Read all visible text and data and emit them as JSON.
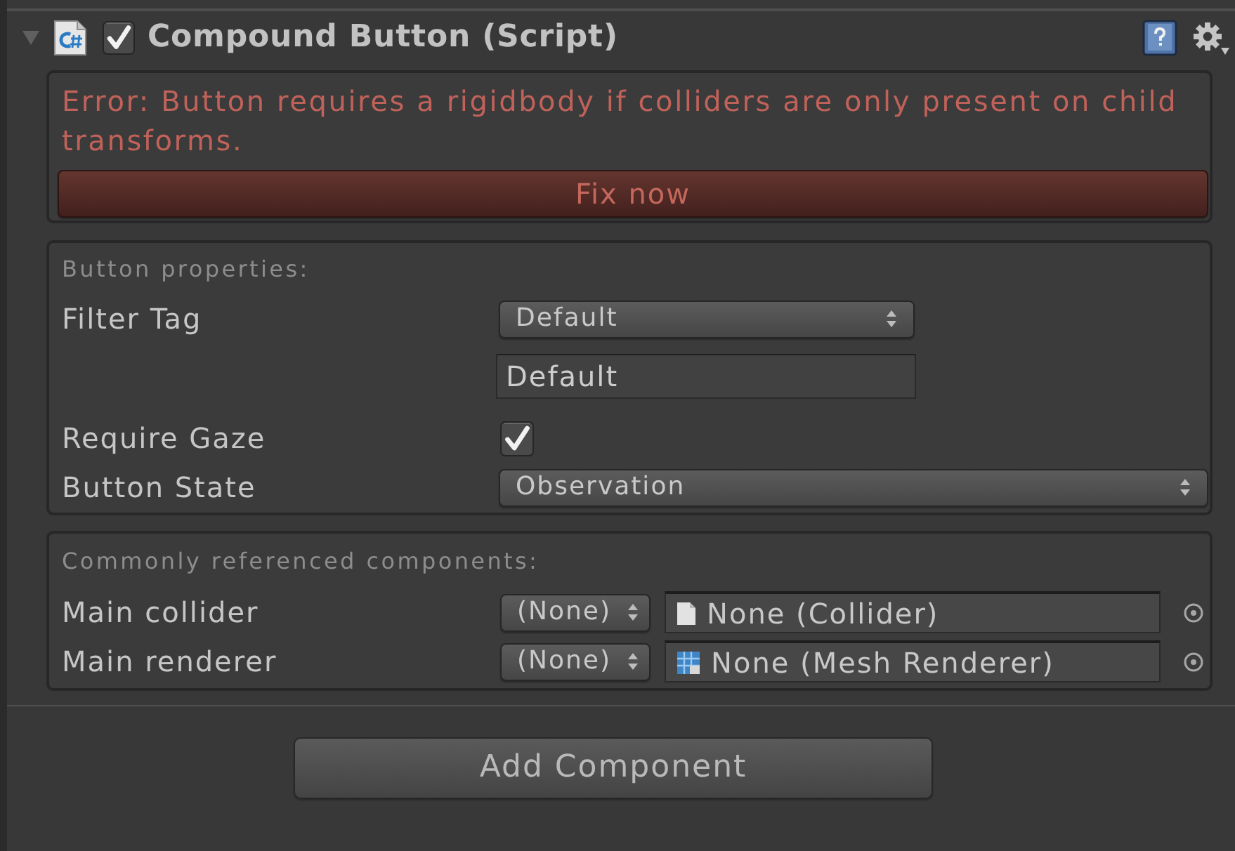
{
  "component": {
    "title": "Compound Button (Script)",
    "expanded": true,
    "enabled": true
  },
  "error": {
    "message": "Error: Button requires a rigidbody if colliders are only present on child transforms.",
    "fix_button": "Fix now"
  },
  "sections": [
    {
      "heading": "Button properties:",
      "fields": [
        {
          "kind": "tag",
          "label": "Filter Tag",
          "dropdown": "Default",
          "value": "Default"
        },
        {
          "kind": "checkbox",
          "label": "Require Gaze",
          "checked": true
        },
        {
          "kind": "dropdown",
          "label": "Button State",
          "value": "Observation"
        }
      ]
    },
    {
      "heading": "Commonly referenced components:",
      "fields": [
        {
          "kind": "object",
          "label": "Main collider",
          "dropdown": "(None)",
          "value": "None (Collider)"
        },
        {
          "kind": "object",
          "label": "Main renderer",
          "dropdown": "(None)",
          "value": "None (Mesh Renderer)"
        }
      ]
    }
  ],
  "add_component_button": "Add Component"
}
